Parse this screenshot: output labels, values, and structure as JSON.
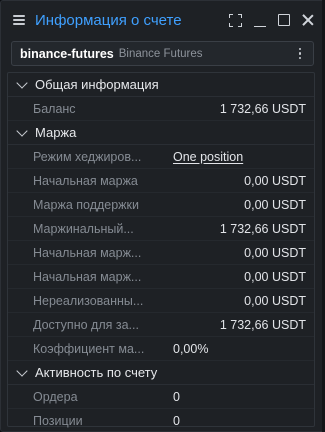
{
  "window": {
    "title": "Информация о счете"
  },
  "account": {
    "name": "binance-futures",
    "exchange": "Binance Futures"
  },
  "sections": {
    "general": {
      "title": "Общая информация",
      "rows": [
        {
          "label": "Баланс",
          "value": "1 732,66 USDT"
        }
      ]
    },
    "margin": {
      "title": "Маржа",
      "rows": [
        {
          "label": "Режим хеджиров...",
          "value": "One position"
        },
        {
          "label": "Начальная маржа",
          "value": "0,00 USDT"
        },
        {
          "label": "Маржа поддержки",
          "value": "0,00 USDT"
        },
        {
          "label": "Маржинальный...",
          "value": "1 732,66 USDT"
        },
        {
          "label": "Начальная марж...",
          "value": "0,00 USDT"
        },
        {
          "label": "Начальная марж...",
          "value": "0,00 USDT"
        },
        {
          "label": "Нереализованны...",
          "value": "0,00 USDT"
        },
        {
          "label": "Доступно для за...",
          "value": "1 732,66 USDT"
        },
        {
          "label": "Коэффициент  ма...",
          "value": "0,00%"
        }
      ]
    },
    "activity": {
      "title": "Активность по счету",
      "rows": [
        {
          "label": "Ордера",
          "value": "0"
        },
        {
          "label": "Позиции",
          "value": "0"
        }
      ]
    }
  },
  "icons": {
    "menu": "hamburger-menu-icon",
    "expand": "expand-icon",
    "minimize": "minimize-icon",
    "maximize": "maximize-icon",
    "close": "close-icon",
    "more": "more-vertical-icon",
    "chevron": "chevron-down-icon"
  },
  "colors": {
    "accent": "#3fa0ff",
    "background": "#1e2125",
    "label": "#858b93",
    "value": "#e2e4e8"
  }
}
